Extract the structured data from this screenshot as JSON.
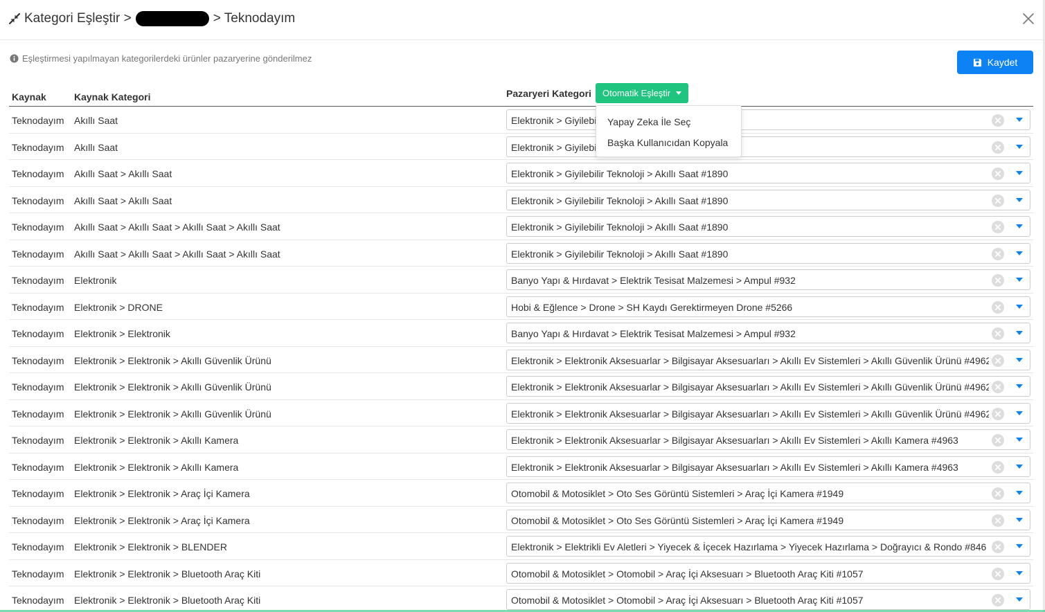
{
  "header": {
    "title_prefix": "Kategori Eşleştir >",
    "title_suffix": "> Teknodayım"
  },
  "notice": "Eşleştirmesi yapılmayan kategorilerdeki ürünler pazaryerine gönderilmez",
  "save_label": "Kaydet",
  "table": {
    "col_source": "Kaynak",
    "col_source_category": "Kaynak Kategori",
    "col_market_category": "Pazaryeri Kategori",
    "auto_match_label": "Otomatik Eşleştir"
  },
  "dropdown": {
    "items": [
      "Yapay Zeka İle Seç",
      "Başka Kullanıcıdan Kopyala"
    ]
  },
  "rows": [
    {
      "source": "Teknodayım",
      "category": "Akıllı Saat",
      "market": "Elektronik > Giyilebilir Teknoloji > Akıllı Saat #1890"
    },
    {
      "source": "Teknodayım",
      "category": "Akıllı Saat",
      "market": "Elektronik > Giyilebilir Teknoloji > Akıllı Saat #1890"
    },
    {
      "source": "Teknodayım",
      "category": "Akıllı Saat > Akıllı Saat",
      "market": "Elektronik > Giyilebilir Teknoloji > Akıllı Saat #1890"
    },
    {
      "source": "Teknodayım",
      "category": "Akıllı Saat > Akıllı Saat",
      "market": "Elektronik > Giyilebilir Teknoloji > Akıllı Saat #1890"
    },
    {
      "source": "Teknodayım",
      "category": "Akıllı Saat > Akıllı Saat > Akıllı Saat > Akıllı Saat",
      "market": "Elektronik > Giyilebilir Teknoloji > Akıllı Saat #1890"
    },
    {
      "source": "Teknodayım",
      "category": "Akıllı Saat > Akıllı Saat > Akıllı Saat > Akıllı Saat",
      "market": "Elektronik > Giyilebilir Teknoloji > Akıllı Saat #1890"
    },
    {
      "source": "Teknodayım",
      "category": "Elektronik",
      "market": "Banyo Yapı & Hırdavat > Elektrik Tesisat Malzemesi > Ampul #932"
    },
    {
      "source": "Teknodayım",
      "category": "Elektronik > DRONE",
      "market": "Hobi & Eğlence > Drone > SH Kaydı Gerektirmeyen Drone #5266"
    },
    {
      "source": "Teknodayım",
      "category": "Elektronik > Elektronik",
      "market": "Banyo Yapı & Hırdavat > Elektrik Tesisat Malzemesi > Ampul #932"
    },
    {
      "source": "Teknodayım",
      "category": "Elektronik > Elektronik > Akıllı Güvenlik Ürünü",
      "market": "Elektronik > Elektronik Aksesuarlar > Bilgisayar Aksesuarları > Akıllı Ev Sistemleri > Akıllı Güvenlik Ürünü #4962"
    },
    {
      "source": "Teknodayım",
      "category": "Elektronik > Elektronik > Akıllı Güvenlik Ürünü",
      "market": "Elektronik > Elektronik Aksesuarlar > Bilgisayar Aksesuarları > Akıllı Ev Sistemleri > Akıllı Güvenlik Ürünü #4962"
    },
    {
      "source": "Teknodayım",
      "category": "Elektronik > Elektronik > Akıllı Güvenlik Ürünü",
      "market": "Elektronik > Elektronik Aksesuarlar > Bilgisayar Aksesuarları > Akıllı Ev Sistemleri > Akıllı Güvenlik Ürünü #4962"
    },
    {
      "source": "Teknodayım",
      "category": "Elektronik > Elektronik > Akıllı Kamera",
      "market": "Elektronik > Elektronik Aksesuarlar > Bilgisayar Aksesuarları > Akıllı Ev Sistemleri > Akıllı Kamera #4963"
    },
    {
      "source": "Teknodayım",
      "category": "Elektronik > Elektronik > Akıllı Kamera",
      "market": "Elektronik > Elektronik Aksesuarlar > Bilgisayar Aksesuarları > Akıllı Ev Sistemleri > Akıllı Kamera #4963"
    },
    {
      "source": "Teknodayım",
      "category": "Elektronik > Elektronik > Araç İçi Kamera",
      "market": "Otomobil & Motosiklet > Oto Ses Görüntü Sistemleri > Araç İçi Kamera #1949"
    },
    {
      "source": "Teknodayım",
      "category": "Elektronik > Elektronik > Araç İçi Kamera",
      "market": "Otomobil & Motosiklet > Oto Ses Görüntü Sistemleri > Araç İçi Kamera #1949"
    },
    {
      "source": "Teknodayım",
      "category": "Elektronik > Elektronik > BLENDER",
      "market": "Elektronik > Elektrikli Ev Aletleri > Yiyecek & İçecek Hazırlama > Yiyecek Hazırlama > Doğrayıcı & Rondo #846"
    },
    {
      "source": "Teknodayım",
      "category": "Elektronik > Elektronik > Bluetooth Araç Kiti",
      "market": "Otomobil & Motosiklet > Otomobil > Araç İçi Aksesuarı > Bluetooth Araç Kiti #1057"
    },
    {
      "source": "Teknodayım",
      "category": "Elektronik > Elektronik > Bluetooth Araç Kiti",
      "market": "Otomobil & Motosiklet > Otomobil > Araç İçi Aksesuarı > Bluetooth Araç Kiti #1057"
    }
  ]
}
